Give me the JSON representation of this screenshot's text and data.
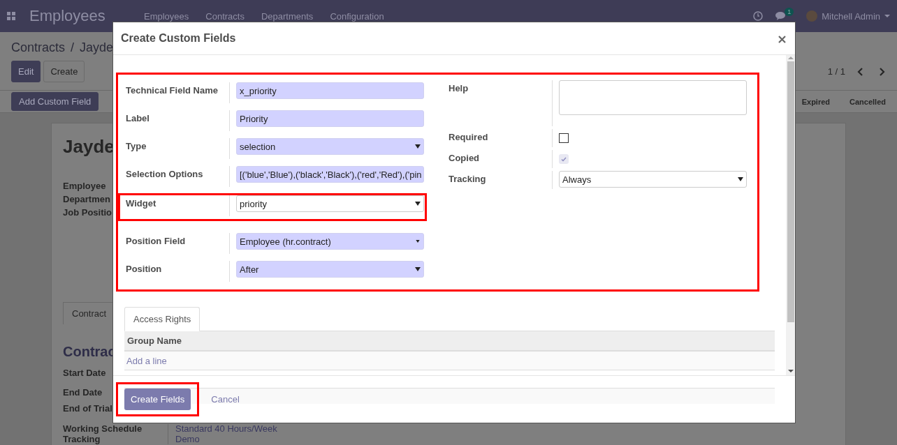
{
  "navbar": {
    "app_title": "Employees",
    "menu": [
      "Employees",
      "Contracts",
      "Departments",
      "Configuration"
    ],
    "chat_count": "1",
    "user": "Mitchell Admin"
  },
  "breadcrumb": {
    "items": [
      "Contracts",
      "Jayde"
    ],
    "separator": "/"
  },
  "actions": [
    "Edit",
    "Create"
  ],
  "add_custom_field": "Add Custom Field",
  "pager": "1 / 1",
  "status_steps": [
    "Expired",
    "Cancelled"
  ],
  "record": {
    "title": "Jayde",
    "labels": [
      "Employee",
      "Departmen",
      "Job Positio"
    ],
    "tab": "Contract",
    "section_title": "Contrac",
    "rows": [
      {
        "label": "Start Date"
      },
      {
        "label": "End Date"
      },
      {
        "label": "End of Trial"
      },
      {
        "label": "Working Schedule",
        "value": "Standard 40 Hours/Week"
      },
      {
        "label": "Tracking",
        "value": "Demo"
      }
    ]
  },
  "modal": {
    "title": "Create Custom Fields",
    "form_highlighted": true,
    "left_fields": [
      {
        "label": "Technical Field Name",
        "kind": "text",
        "value": "x_priority",
        "required": true,
        "highlighted": false
      },
      {
        "label": "Label",
        "kind": "text",
        "value": "Priority",
        "required": true,
        "highlighted": false
      },
      {
        "label": "Type",
        "kind": "select",
        "value": "selection",
        "required": true,
        "highlighted": false
      },
      {
        "label": "Selection Options",
        "kind": "text",
        "value": "[('blue','Blue'),('black','Black'),('red','Red'),('pin",
        "required": true,
        "highlighted": false
      },
      {
        "label": "Widget",
        "kind": "select",
        "value": "priority",
        "required": false,
        "highlighted": true
      },
      {
        "label": "Position Field",
        "kind": "many2one",
        "value": "Employee (hr.contract)",
        "required": true,
        "highlighted": false
      },
      {
        "label": "Position",
        "kind": "select",
        "value": "After",
        "required": true,
        "highlighted": false
      }
    ],
    "right_fields": [
      {
        "label": "Help",
        "kind": "textarea",
        "required": false
      },
      {
        "label": "Required",
        "kind": "checkbox",
        "checked": false,
        "disabled": false
      },
      {
        "label": "Copied",
        "kind": "checkbox",
        "checked": true,
        "disabled": true
      },
      {
        "label": "Tracking",
        "kind": "select",
        "value": "Always",
        "required": false
      }
    ],
    "tabs": [
      {
        "label": "Access Rights",
        "selected": true
      }
    ],
    "table": {
      "columns": [
        "Group Name"
      ],
      "add_line": "Add a line"
    },
    "buttons": [
      {
        "label": "Create Fields",
        "kind": "primary",
        "highlighted": true
      },
      {
        "label": "Cancel",
        "kind": "link",
        "highlighted": false
      }
    ]
  }
}
